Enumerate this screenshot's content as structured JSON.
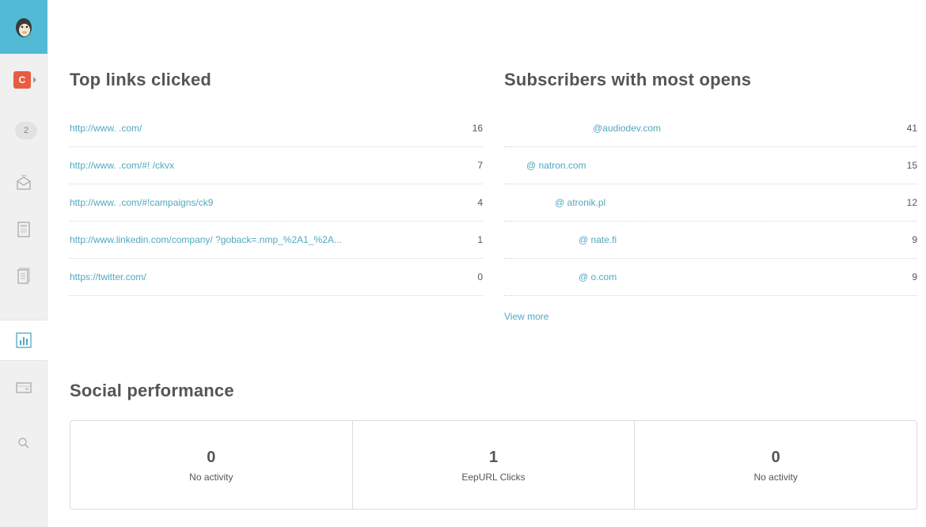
{
  "sidebar": {
    "account_initial": "C",
    "notification_count": "2",
    "icons": [
      "campaigns-icon",
      "templates-icon",
      "lists-icon",
      "reports-icon",
      "automation-icon",
      "search-icon"
    ]
  },
  "top_links": {
    "title": "Top links clicked",
    "rows": [
      {
        "link": "http://www.              .com/",
        "count": "16"
      },
      {
        "link": "http://www.              .com/#!          /ckvx",
        "count": "7"
      },
      {
        "link": "http://www.              .com/#!campaigns/ck9",
        "count": "4"
      },
      {
        "link": "http://www.linkedin.com/company/                    ?goback=.nmp_%2A1_%2A...",
        "count": "1"
      },
      {
        "link": "https://twitter.com/",
        "count": "0"
      }
    ]
  },
  "subscribers": {
    "title": "Subscribers with most opens",
    "rows": [
      {
        "email": "@audiodev.com",
        "count": "41"
      },
      {
        "email": "@      natron.com",
        "count": "15"
      },
      {
        "email": "@      atronik.pl",
        "count": "12"
      },
      {
        "email": "@           nate.fi",
        "count": "9"
      },
      {
        "email": "@           o.com",
        "count": "9"
      }
    ],
    "view_more": "View more"
  },
  "social": {
    "title": "Social performance",
    "cells": [
      {
        "value": "0",
        "label": "No activity"
      },
      {
        "value": "1",
        "label": "EepURL Clicks"
      },
      {
        "value": "0",
        "label": "No activity"
      }
    ]
  },
  "colors": {
    "accent": "#52bad5",
    "link": "#52a8c0",
    "account_badge": "#e85c41"
  }
}
